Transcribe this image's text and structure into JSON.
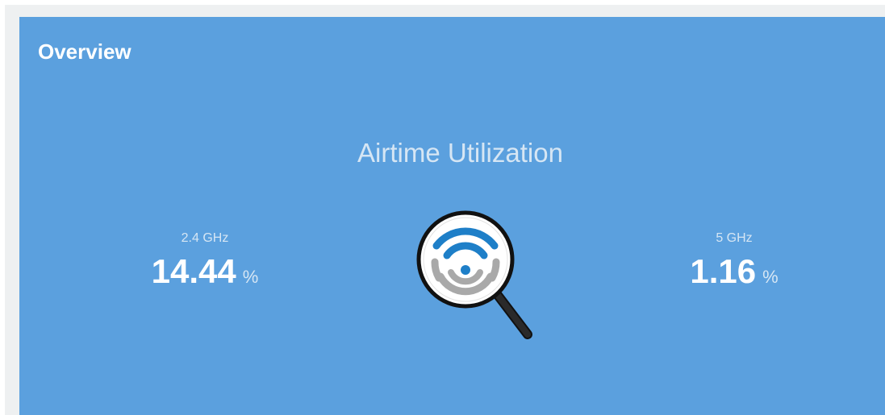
{
  "panel": {
    "title": "Overview"
  },
  "widget": {
    "title": "Airtime Utilization",
    "icon": "wifi-magnifier-icon",
    "accent_color": "#1e7fc8",
    "background_color": "#5ba0de"
  },
  "metrics": [
    {
      "label": "2.4 GHz",
      "value": "14.44",
      "unit": "%"
    },
    {
      "label": "5 GHz",
      "value": "1.16",
      "unit": "%"
    }
  ]
}
